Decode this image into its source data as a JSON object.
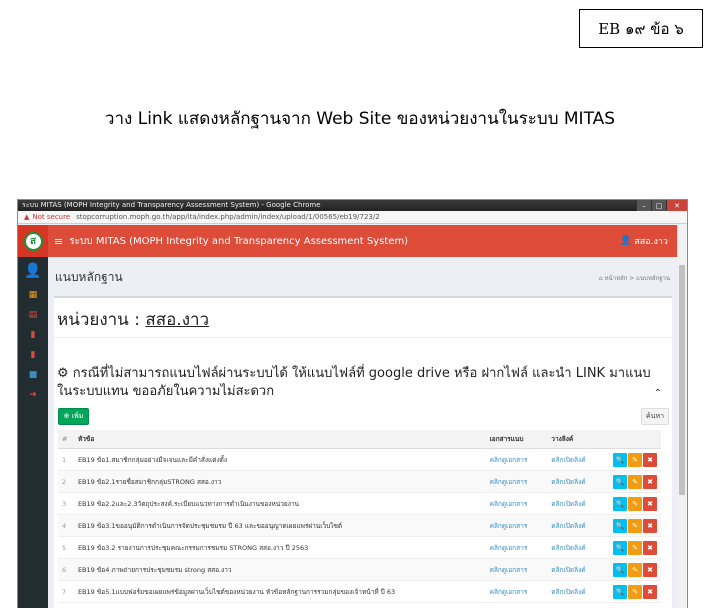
{
  "page_label": "EB ๑๙  ข้อ ๖",
  "headline": "วาง Link แสดงหลักฐานจาก Web Site ของหน่วยงานในระบบ MITAS",
  "browser": {
    "window_title": "ระบบ MITAS (MOPH Integrity and Transparency Assessment System) - Google Chrome",
    "not_secure": "Not secure",
    "url": "stopcorruption.moph.go.th/app/ita/index.php/admin/index/upload/1/00565/eb19/723/2"
  },
  "app": {
    "logo_letter": "ส",
    "hamburger": "≡",
    "title": "ระบบ MITAS (MOPH Integrity and Transparency Assessment System)",
    "user": "สสอ.งาว",
    "colors": {
      "header": "#dd4b39",
      "sidebar": "#222d32",
      "add": "#00a65a",
      "link": "#3c8dbc"
    }
  },
  "sidebar": {
    "avatar": "👤",
    "icons": [
      {
        "glyph": "▦",
        "color": "#f39c12"
      },
      {
        "glyph": "▤",
        "color": "#dd4b39"
      },
      {
        "glyph": "▮",
        "color": "#dd4b39"
      },
      {
        "glyph": "▮",
        "color": "#dd4b39"
      },
      {
        "glyph": "■",
        "color": "#3c8dbc"
      },
      {
        "glyph": "➜",
        "color": "#dd4b39"
      }
    ]
  },
  "content": {
    "section_title": "แนบหลักฐาน",
    "breadcrumb_home": "⌂ หน้าหลัก",
    "breadcrumb_current": "แนบหลักฐาน",
    "unit_label": "หน่วยงาน :",
    "unit_name": "สสอ.งาว",
    "notice": "⚙ กรณีที่ไม่สามารถแนบไฟล์ผ่านระบบได้ ให้แนบไฟล์ที่ google drive หรือ ฝากไฟล์ และนำ LINK มาแนบในระบบแทน ขออภัยในความไม่สะดวก",
    "add_button": "⊕ เพิ่ม",
    "search_button": "ค้นหา"
  },
  "table": {
    "headers": {
      "no": "#",
      "topic": "หัวข้อ",
      "doc": "เอกสารแนบ",
      "link": "วางลิงค์"
    },
    "rows": [
      {
        "no": "1",
        "topic": "EB19 ข้อ1.สมาชิกกลุ่มอย่างมีจเจนและมีคำสั่งแต่งตั้ง",
        "doc": "คลิกดูเอกสาร",
        "link": "คลิกเปิดลิงค์"
      },
      {
        "no": "2",
        "topic": "EB19 ข้อ2.1รายชื่อสมาชิกกลุ่มSTRONG สสอ.งาว",
        "doc": "คลิกดูเอกสาร",
        "link": "คลิกเปิดลิงค์"
      },
      {
        "no": "3",
        "topic": "EB19 ข้อ2.2และ2.3วัตถุประสงค์,ระเบียบแนวทางการดำเนินงานของหน่วยงาน",
        "doc": "คลิกดูเอกสาร",
        "link": "คลิกเปิดลิงค์"
      },
      {
        "no": "4",
        "topic": "EB19 ข้อ3.1ขออนุมัติการดำเนินการจัดประชุมชมรม ปี 63 และขออนุญาตเผยแพร่ผ่านเว็บไซต์",
        "doc": "คลิกดูเอกสาร",
        "link": "คลิกเปิดลิงค์"
      },
      {
        "no": "5",
        "topic": "EB19 ข้อ3.2 รายงานการประชุมคณะกรรมการชมรม STRONG สสอ.งาว ปี 2563",
        "doc": "คลิกดูเอกสาร",
        "link": "คลิกเปิดลิงค์"
      },
      {
        "no": "6",
        "topic": "EB19 ข้อ4 ภาพถ่ายการประชุมชมรม strong สสอ.งาว",
        "doc": "คลิกดูเอกสาร",
        "link": "คลิกเปิดลิงค์"
      },
      {
        "no": "7",
        "topic": "EB19 ข้อ5.1แบบฟอร์มขอเผยแพร่ข้อมูลผ่านเว็บไซต์ของหน่วยงาน หัวข้อหลักฐานการรวมกลุ่มของเจ้าหน้าที่ ปี 63",
        "doc": "คลิกดูเอกสาร",
        "link": "คลิกเปิดลิงค์"
      }
    ],
    "action_icons": {
      "view": "🔍",
      "edit": "✎",
      "delete": "✖"
    }
  }
}
